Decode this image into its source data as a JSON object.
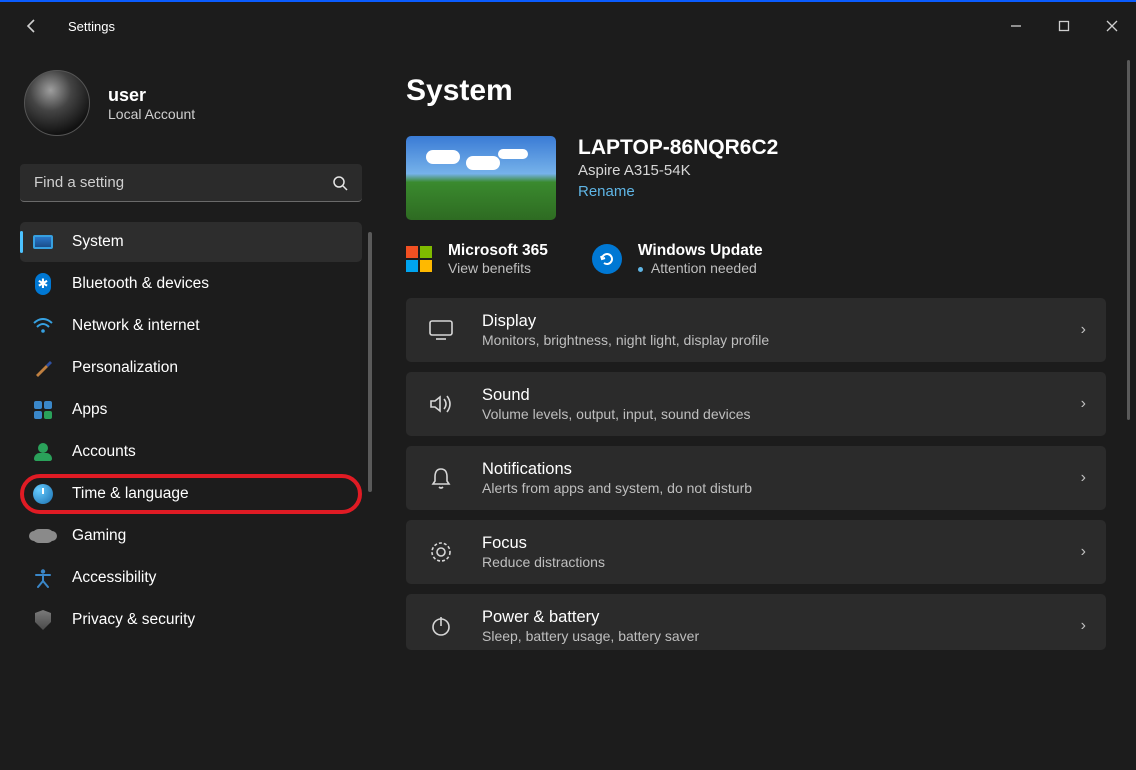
{
  "titlebar": {
    "title": "Settings"
  },
  "profile": {
    "name": "user",
    "account": "Local Account"
  },
  "search": {
    "placeholder": "Find a setting"
  },
  "nav": [
    {
      "label": "System"
    },
    {
      "label": "Bluetooth & devices"
    },
    {
      "label": "Network & internet"
    },
    {
      "label": "Personalization"
    },
    {
      "label": "Apps"
    },
    {
      "label": "Accounts"
    },
    {
      "label": "Time & language"
    },
    {
      "label": "Gaming"
    },
    {
      "label": "Accessibility"
    },
    {
      "label": "Privacy & security"
    }
  ],
  "page": {
    "title": "System"
  },
  "device": {
    "name": "LAPTOP-86NQR6C2",
    "model": "Aspire A315-54K",
    "rename": "Rename"
  },
  "tiles": {
    "m365": {
      "title": "Microsoft 365",
      "sub": "View benefits"
    },
    "wu": {
      "title": "Windows Update",
      "sub": "Attention needed"
    }
  },
  "cards": [
    {
      "title": "Display",
      "sub": "Monitors, brightness, night light, display profile"
    },
    {
      "title": "Sound",
      "sub": "Volume levels, output, input, sound devices"
    },
    {
      "title": "Notifications",
      "sub": "Alerts from apps and system, do not disturb"
    },
    {
      "title": "Focus",
      "sub": "Reduce distractions"
    },
    {
      "title": "Power & battery",
      "sub": "Sleep, battery usage, battery saver"
    }
  ]
}
